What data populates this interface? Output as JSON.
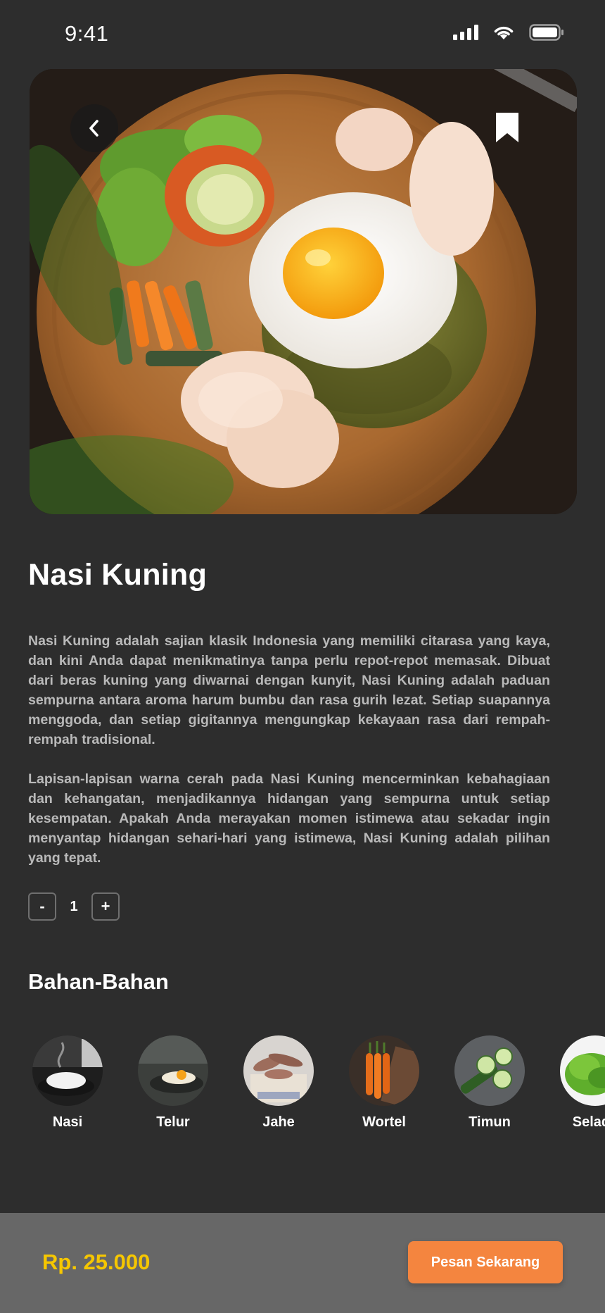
{
  "status_bar": {
    "time": "9:41",
    "icons": [
      "signal-icon",
      "wifi-icon",
      "battery-icon"
    ]
  },
  "hero": {
    "icons": [
      "back-chevron-icon",
      "bookmark-icon"
    ]
  },
  "dish": {
    "title": "Nasi Kuning",
    "description": [
      "Nasi Kuning adalah sajian klasik Indonesia yang memiliki citarasa yang kaya, dan kini Anda dapat menikmatinya tanpa perlu repot-repot memasak. Dibuat dari beras kuning yang diwarnai dengan kunyit, Nasi Kuning adalah paduan sempurna antara aroma harum bumbu dan rasa gurih lezat. Setiap suapannya menggoda, dan setiap gigitannya mengungkap kekayaan rasa dari rempah-rempah tradisional.",
      "Lapisan-lapisan warna cerah pada Nasi Kuning mencerminkan kebahagiaan dan kehangatan, menjadikannya hidangan yang sempurna untuk setiap kesempatan. Apakah Anda merayakan momen istimewa atau sekadar ingin menyantap hidangan sehari-hari yang istimewa, Nasi Kuning adalah pilihan yang tepat."
    ]
  },
  "quantity": {
    "minus_label": "-",
    "value": "1",
    "plus_label": "+"
  },
  "ingredients": {
    "title": "Bahan-Bahan",
    "items": [
      {
        "label": "Nasi"
      },
      {
        "label": "Telur"
      },
      {
        "label": "Jahe"
      },
      {
        "label": "Wortel"
      },
      {
        "label": "Timun"
      },
      {
        "label": "Selada"
      }
    ]
  },
  "footer": {
    "price": "Rp. 25.000",
    "order_label": "Pesan Sekarang"
  },
  "colors": {
    "background": "#2d2d2d",
    "bottom_bar": "#676767",
    "price": "#f6c700",
    "accent": "#f4853f"
  }
}
